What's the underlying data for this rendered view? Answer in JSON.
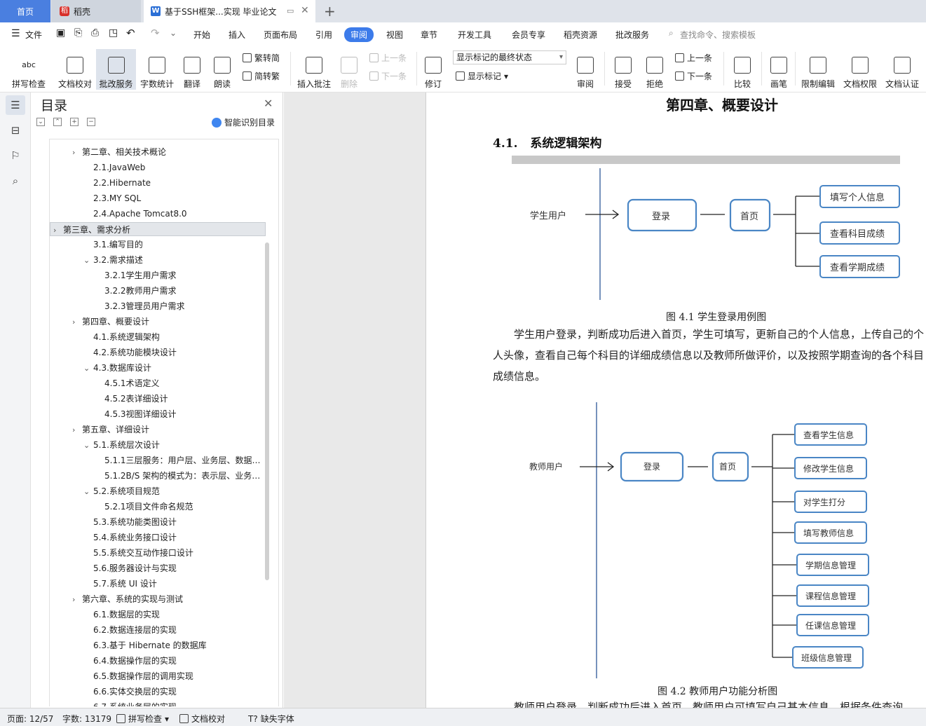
{
  "titlebar": {
    "tabs": [
      {
        "label": "首页"
      },
      {
        "label": "稻壳"
      },
      {
        "label": "基于SSH框架...实现 毕业论文"
      }
    ]
  },
  "menu": {
    "file": "文件",
    "items": [
      "开始",
      "插入",
      "页面布局",
      "引用",
      "审阅",
      "视图",
      "章节",
      "开发工具",
      "会员专享",
      "稻壳资源",
      "批改服务"
    ],
    "search": "查找命令、搜索模板"
  },
  "ribbon": {
    "spellcheck": "拼写检查",
    "doc_proof": "文档校对",
    "grade_service": "批改服务",
    "word_count": "字数统计",
    "translate": "翻译",
    "read_aloud": "朗读",
    "trad_to_simp": "繁转简",
    "simp_to_trad": "简转繁",
    "insert_comment": "插入批注",
    "delete": "删除",
    "prev": "上一条",
    "next": "下一条",
    "revise": "修订",
    "markup_state": "显示标记的最终状态",
    "show_markup": "显示标记",
    "review": "审阅",
    "accept": "接受",
    "reject": "拒绝",
    "prev2": "上一条",
    "next2": "下一条",
    "compare": "比较",
    "pen": "画笔",
    "restrict_edit": "限制编辑",
    "doc_rights": "文档权限",
    "doc_cert": "文档认证"
  },
  "toc": {
    "title": "目录",
    "smart": "智能识别目录",
    "items": [
      {
        "label": "第二章、相关技术概论",
        "level": 1,
        "arrow": "›"
      },
      {
        "label": "2.1.JavaWeb",
        "level": 2,
        "arrow": ""
      },
      {
        "label": "2.2.Hibernate",
        "level": 2,
        "arrow": ""
      },
      {
        "label": "2.3.MY SQL",
        "level": 2,
        "arrow": ""
      },
      {
        "label": "2.4.Apache Tomcat8.0",
        "level": 2,
        "arrow": ""
      },
      {
        "label": "第三章、需求分析",
        "level": 0,
        "arrow": "›",
        "selected": true
      },
      {
        "label": "3.1.编写目的",
        "level": 2,
        "arrow": ""
      },
      {
        "label": "3.2.需求描述",
        "level": 2,
        "arrow": "⌄"
      },
      {
        "label": "3.2.1学生用户需求",
        "level": 3,
        "arrow": ""
      },
      {
        "label": "3.2.2教师用户需求",
        "level": 3,
        "arrow": ""
      },
      {
        "label": "3.2.3管理员用户需求",
        "level": 3,
        "arrow": ""
      },
      {
        "label": "第四章、概要设计",
        "level": 1,
        "arrow": "›"
      },
      {
        "label": "4.1.系统逻辑架构",
        "level": 2,
        "arrow": ""
      },
      {
        "label": "4.2.系统功能模块设计",
        "level": 2,
        "arrow": ""
      },
      {
        "label": "4.3.数据库设计",
        "level": 2,
        "arrow": "⌄"
      },
      {
        "label": "4.5.1术语定义",
        "level": 3,
        "arrow": ""
      },
      {
        "label": "4.5.2表详细设计",
        "level": 3,
        "arrow": ""
      },
      {
        "label": "4.5.3视图详细设计",
        "level": 3,
        "arrow": ""
      },
      {
        "label": "第五章、详细设计",
        "level": 1,
        "arrow": "›"
      },
      {
        "label": "5.1.系统层次设计",
        "level": 2,
        "arrow": "⌄"
      },
      {
        "label": "5.1.1三层服务：用户层、业务层、数据层 ...",
        "level": 3,
        "arrow": ""
      },
      {
        "label": "5.1.2B/S 架构的模式为：表示层、业务层 ...",
        "level": 3,
        "arrow": ""
      },
      {
        "label": "5.2.系统项目规范",
        "level": 2,
        "arrow": "⌄"
      },
      {
        "label": "5.2.1项目文件命名规范",
        "level": 3,
        "arrow": ""
      },
      {
        "label": "5.3.系统功能类图设计",
        "level": 2,
        "arrow": ""
      },
      {
        "label": "5.4.系统业务接口设计",
        "level": 2,
        "arrow": ""
      },
      {
        "label": "5.5.系统交互动作接口设计",
        "level": 2,
        "arrow": ""
      },
      {
        "label": "5.6.服务器设计与实现",
        "level": 2,
        "arrow": ""
      },
      {
        "label": "5.7.系统 UI 设计",
        "level": 2,
        "arrow": ""
      },
      {
        "label": "第六章、系统的实现与测试",
        "level": 1,
        "arrow": "›"
      },
      {
        "label": "6.1.数据层的实现",
        "level": 2,
        "arrow": ""
      },
      {
        "label": "6.2.数据连接层的实现",
        "level": 2,
        "arrow": ""
      },
      {
        "label": "6.3.基于 Hibernate 的数据库",
        "level": 2,
        "arrow": ""
      },
      {
        "label": "6.4.数据操作层的实现",
        "level": 2,
        "arrow": ""
      },
      {
        "label": "6.5.数据操作层的调用实现",
        "level": 2,
        "arrow": ""
      },
      {
        "label": "6.6.实体交换层的实现",
        "level": 2,
        "arrow": ""
      },
      {
        "label": "6.7.系统业务层的实现",
        "level": 2,
        "arrow": ""
      }
    ]
  },
  "document": {
    "chapter_title": "第四章、概要设计",
    "section_number": "4.1.",
    "section_title": "系统逻辑架构",
    "fig1": {
      "actor": "学生用户",
      "login": "登录",
      "home": "首页",
      "functions": [
        "填写个人信息",
        "查看科目成绩",
        "查看学期成绩"
      ],
      "caption": "图 4.1 学生登录用例图"
    },
    "paragraph1": "学生用户登录，判断成功后进入首页，学生可填写，更新自己的个人信息，上传自己的个人头像，查看自己每个科目的详细成绩信息以及教师所做评价，以及按照学期查询的各个科目成绩信息。",
    "fig2": {
      "actor": "教师用户",
      "login": "登录",
      "home": "首页",
      "functions": [
        "查看学生信息",
        "修改学生信息",
        "对学生打分",
        "填写教师信息",
        "学期信息管理",
        "课程信息管理",
        "任课信息管理",
        "班级信息管理"
      ],
      "caption": "图 4.2   教师用户功能分析图"
    },
    "paragraph2_partial": "教师用户登录，判断成功后进入首页，教师用户可填写自己基本信息，根据条件查询"
  },
  "status": {
    "page": "页面: 12/57",
    "words": "字数: 13179",
    "spell": "拼写检查",
    "proof": "文档校对",
    "missing_font": "缺失字体"
  }
}
